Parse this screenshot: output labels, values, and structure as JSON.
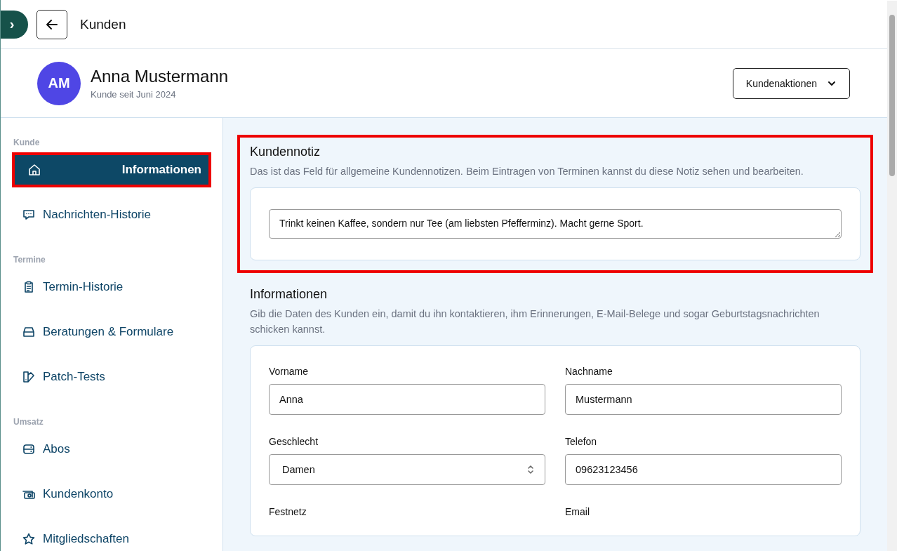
{
  "topbar": {
    "toggle_label": "›",
    "title": "Kunden"
  },
  "customer": {
    "initials": "AM",
    "name": "Anna Mustermann",
    "since": "Kunde seit Juni 2024",
    "actions_button": "Kundenaktionen"
  },
  "sidebar": {
    "sections": [
      {
        "title": "Kunde",
        "items": [
          {
            "label": "Informationen",
            "selected": true,
            "highlighted": true
          },
          {
            "label": "Nachrichten-Historie",
            "selected": false,
            "highlighted": false
          }
        ]
      },
      {
        "title": "Termine",
        "items": [
          {
            "label": "Termin-Historie",
            "selected": false,
            "highlighted": false
          },
          {
            "label": "Beratungen & Formulare",
            "selected": false,
            "highlighted": false
          },
          {
            "label": "Patch-Tests",
            "selected": false,
            "highlighted": false
          }
        ]
      },
      {
        "title": "Umsatz",
        "items": [
          {
            "label": "Abos",
            "selected": false,
            "highlighted": false
          },
          {
            "label": "Kundenkonto",
            "selected": false,
            "highlighted": false
          },
          {
            "label": "Mitgliedschaften",
            "selected": false,
            "highlighted": false
          }
        ]
      }
    ]
  },
  "note_section": {
    "title": "Kundennotiz",
    "description": "Das ist das Feld für allgemeine Kundennotizen. Beim Eintragen von Terminen kannst du diese Notiz sehen und bearbeiten.",
    "value": "Trinkt keinen Kaffee, sondern nur Tee (am liebsten Pfefferminz). Macht gerne Sport.",
    "highlighted": true
  },
  "info_section": {
    "title": "Informationen",
    "description": "Gib die Daten des Kunden ein, damit du ihn kontaktieren, ihm Erinnerungen, E-Mail-Belege und sogar Geburtstagsnachrichten schicken kannst.",
    "fields": [
      {
        "label": "Vorname",
        "kind": "text",
        "value": "Anna"
      },
      {
        "label": "Nachname",
        "kind": "text",
        "value": "Mustermann"
      },
      {
        "label": "Geschlecht",
        "kind": "select",
        "value": "Damen"
      },
      {
        "label": "Telefon",
        "kind": "text",
        "value": "09623123456"
      },
      {
        "label": "Festnetz",
        "kind": "cut"
      },
      {
        "label": "Email",
        "kind": "cut"
      }
    ]
  }
}
